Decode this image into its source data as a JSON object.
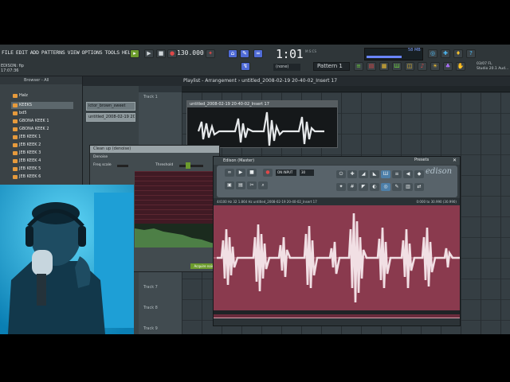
{
  "menu": [
    "FILE",
    "EDIT",
    "ADD",
    "PATTERNS",
    "VIEW",
    "OPTIONS",
    "TOOLS",
    "HELP"
  ],
  "hint": {
    "line1": "EDISON: fip",
    "line2": "17:07:36"
  },
  "transport": {
    "tempo": "130.000",
    "clock": "1:01",
    "clock_sub": "00",
    "clock_unit": "M:S:CS",
    "pattern": "Pattern 1",
    "none": "(none)",
    "mem": "58 MB"
  },
  "news": {
    "line1": "03/07 FL",
    "line2": "Studio 20.1 Aud..."
  },
  "browser": {
    "title": "Browser - All",
    "items": [
      "Halz",
      "KEEKS",
      "bd5",
      "GBONA KEEK 1",
      "GBONA KEEK 2",
      "JEB KEEK 1",
      "JEB KEEK 2",
      "JEB KEEK 3",
      "JEB KEEK 4",
      "JEB KEEK 5",
      "JEB KEEK 6"
    ]
  },
  "playlist": {
    "title": "Playlist - Arrangement",
    "path": "untitled_2008-02-19 20-40-02_Insert 17",
    "picker": [
      "ictor_brown_sweet",
      "untitled_2008-02-19 20"
    ],
    "tracks": [
      "Track 1",
      "Track 7",
      "Track 8",
      "Track 9"
    ],
    "clip_title": "untitled_2008-02-19 20-40-02_Insert 17"
  },
  "cleanup": {
    "title": "Clean up (denoise)",
    "checkbox": "Denoise",
    "freq_label": "Freq scale",
    "threshold_label": "Threshold",
    "extra": "Output noise only",
    "accept": "Acquire noise"
  },
  "edison": {
    "title": "Edison (Master)",
    "logo": "edison",
    "presets": "Presets",
    "on_input": "ON INPUT",
    "rec_value": "30",
    "info": "44100 Hz   32   1.864 Hz   untitled_2008-02-19 20-40-02_Insert 17",
    "right_info": "0:000 to 30.990 (30.990)"
  }
}
